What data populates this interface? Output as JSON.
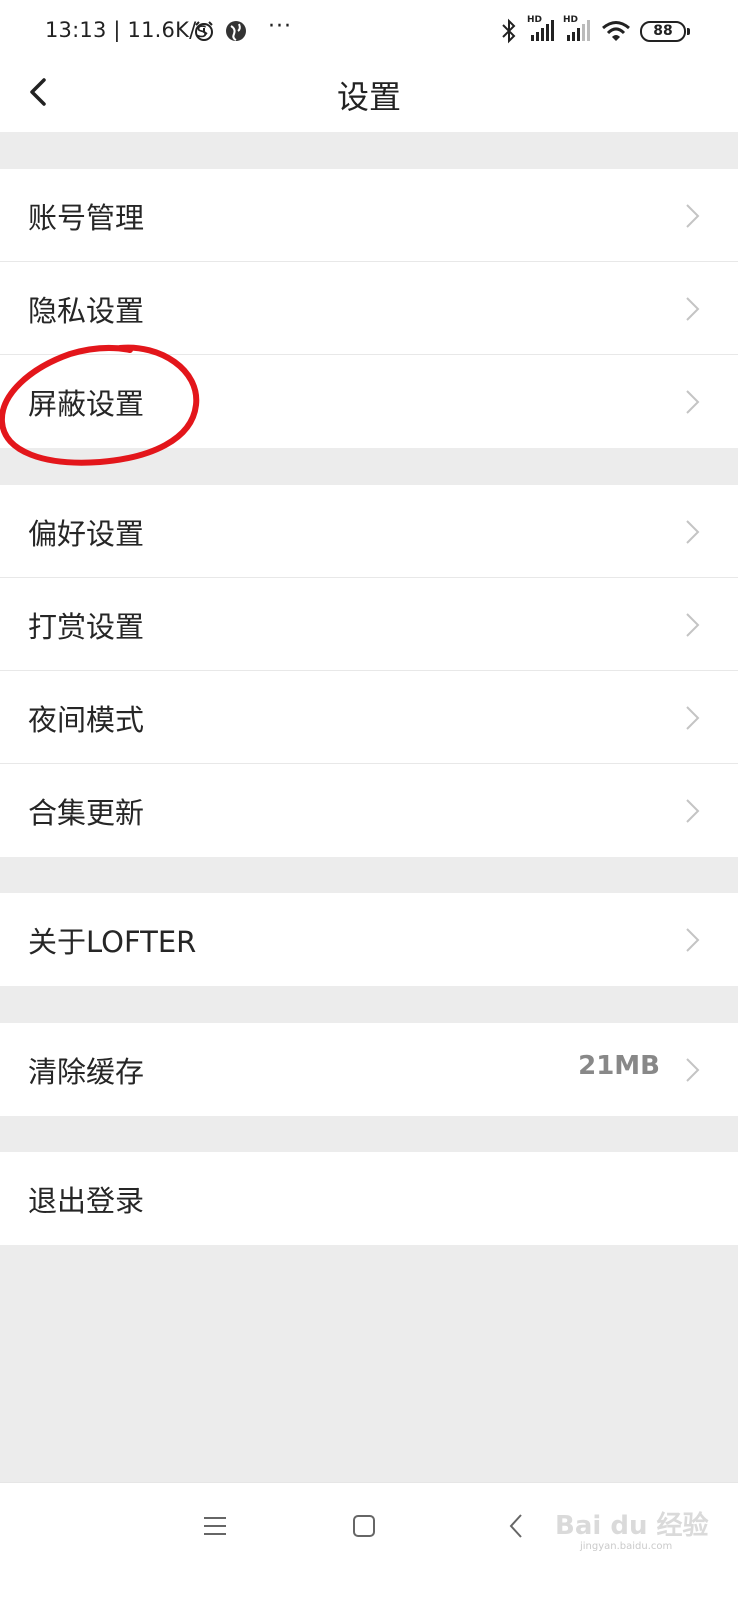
{
  "status_bar": {
    "time_speed": "13:13 | 11.6K/s",
    "more": "···",
    "hd1": "HD",
    "hd2": "HD",
    "battery": "88"
  },
  "header": {
    "title": "设置"
  },
  "settings": {
    "account": "账号管理",
    "privacy": "隐私设置",
    "block": "屏蔽设置",
    "preference": "偏好设置",
    "reward": "打赏设置",
    "night_mode": "夜间模式",
    "collection_update": "合集更新",
    "about": "关于LOFTER",
    "clear_cache": "清除缓存",
    "cache_size": "21MB",
    "logout": "退出登录"
  },
  "watermark": {
    "brand": "Bai du 经验",
    "url": "jingyan.baidu.com"
  },
  "colors": {
    "annotation": "#e3161b",
    "background": "#ececec",
    "chevron": "#c4c4c4"
  }
}
